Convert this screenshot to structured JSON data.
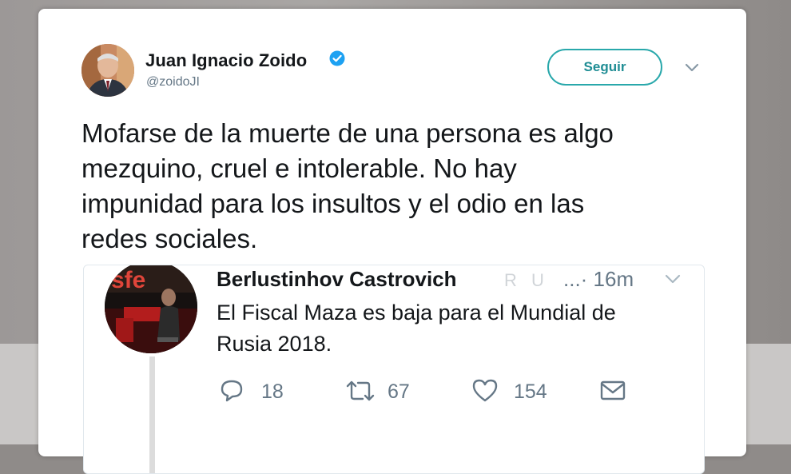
{
  "tweet": {
    "author_name": "Juan Ignacio Zoido",
    "author_handle": "@zoidoJI",
    "follow_label": "Seguir",
    "text": "Mofarse de la muerte de una persona es algo\nmezquino, cruel e intolerable. No hay\nimpunidad para los insultos y el odio en las\nredes sociales."
  },
  "quoted": {
    "author_name": "Berlustinhov Castrovich",
    "badges": "R U",
    "time": "...· 16m",
    "text": "El Fiscal Maza es baja para el Mundial de\nRusia 2018.",
    "reply_count": "18",
    "retweet_count": "67",
    "like_count": "154"
  },
  "icons": {
    "verified": "verified-badge-icon",
    "caret": "chevron-down-icon",
    "reply": "reply-icon",
    "retweet": "retweet-icon",
    "like": "heart-icon",
    "dm": "envelope-icon"
  },
  "colors": {
    "accent": "#1da1f2",
    "follow_border": "#29a8ab",
    "muted": "#657786"
  }
}
